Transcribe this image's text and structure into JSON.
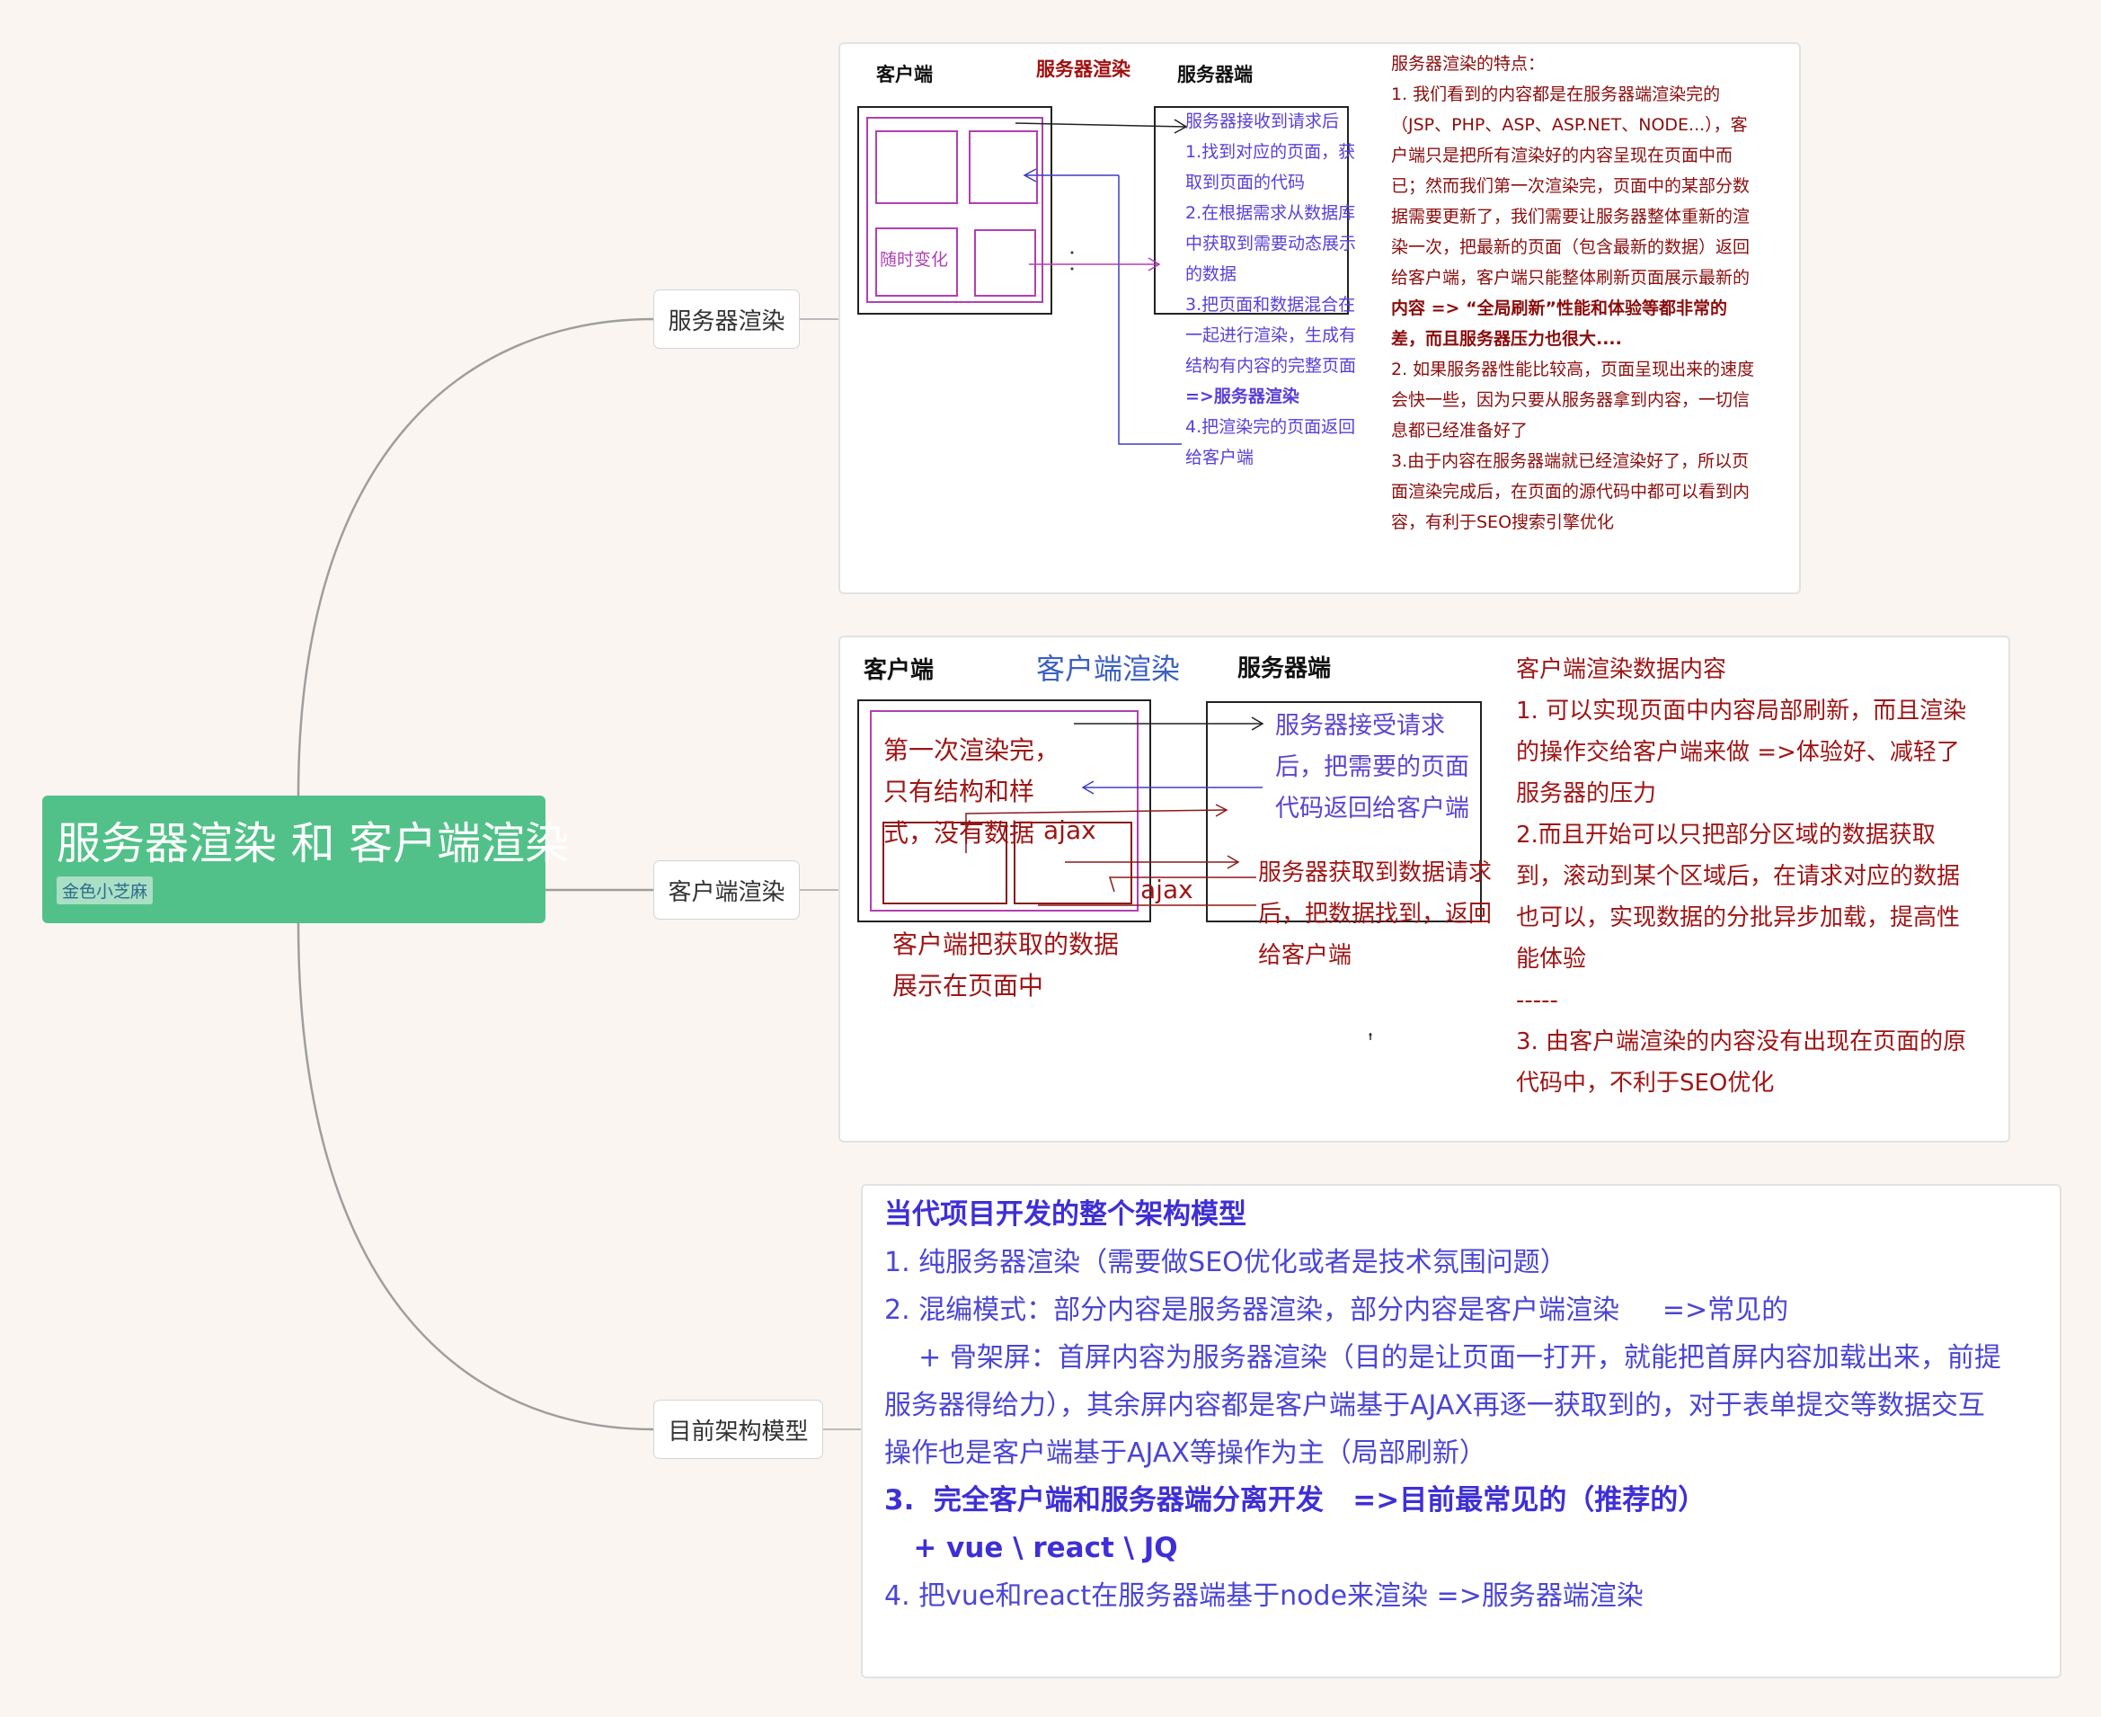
{
  "root": {
    "title": "服务器渲染 和 客户端渲染",
    "tag": "金色小芝麻"
  },
  "branches": {
    "ssr": "服务器渲染",
    "csr": "客户端渲染",
    "arch": "目前架构模型"
  },
  "ssr_card": {
    "client_label": "客户端",
    "render_label": "服务器渲染",
    "server_label": "服务器端",
    "random_change": "随时变化",
    "steps": [
      "服务器接收到请求后",
      "1.找到对应的页面，获",
      "取到页面的代码",
      "2.在根据需求从数据库",
      "中获取到需要动态展示",
      "的数据",
      "3.把页面和数据混合在",
      "一起进行渲染，生成有",
      "结构有内容的完整页面",
      "=>服务器渲染",
      "4.把渲染完的页面返回",
      "给客户端"
    ],
    "features": [
      "服务器渲染的特点：",
      "1. 我们看到的内容都是在服务器端渲染完的",
      "（JSP、PHP、ASP、ASP.NET、NODE...），客",
      "户端只是把所有渲染好的内容呈现在页面中而",
      "已；然而我们第一次渲染完，页面中的某部分数",
      "据需要更新了，我们需要让服务器整体重新的渲",
      "染一次，把最新的页面（包含最新的数据）返回",
      "给客户端，客户端只能整体刷新页面展示最新的",
      "内容 => “全局刷新”性能和体验等都非常的",
      "差，而且服务器压力也很大....",
      "2. 如果服务器性能比较高，页面呈现出来的速度",
      "会快一些，因为只要从服务器拿到内容，一切信",
      "息都已经准备好了",
      "3.由于内容在服务器端就已经渲染好了，所以页",
      "面渲染完成后，在页面的源代码中都可以看到内",
      "容，有利于SEO搜索引擎优化"
    ]
  },
  "csr_card": {
    "client_label": "客户端",
    "render_label": "客户端渲染",
    "server_label": "服务器端",
    "first_render": [
      "第一次渲染完，",
      "只有结构和样",
      "式，没有数据"
    ],
    "ajax1": "ajax",
    "ajax2": "ajax",
    "display": [
      "客户端把获取的数据",
      "展示在页面中"
    ],
    "server_steps_1": [
      "服务器接受请求",
      "后，把需要的页面",
      "代码返回给客户端"
    ],
    "server_steps_2": [
      "服务器获取到数据请求",
      "后，把数据找到，返回",
      "给客户端"
    ],
    "notes": [
      "客户端渲染数据内容",
      "1. 可以实现页面中内容局部刷新，而且渲染",
      "的操作交给客户端来做 =>体验好、减轻了",
      "服务器的压力",
      "2.而且开始可以只把部分区域的数据获取",
      "到，滚动到某个区域后，在请求对应的数据",
      "也可以，实现数据的分批异步加载，提高性",
      "能体验",
      "-----",
      "3. 由客户端渲染的内容没有出现在页面的原",
      "代码中，不利于SEO优化"
    ]
  },
  "arch_card": {
    "title": "当代项目开发的整个架构模型",
    "lines": [
      "1. 纯服务器渲染（需要做SEO优化或者是技术氛围问题）",
      "2. 混编模式：部分内容是服务器渲染，部分内容是客户端渲染     =>常见的",
      "    + 骨架屏：首屏内容为服务器渲染（目的是让页面一打开，就能把首屏内容加载出来，前提",
      "服务器得给力），其余屏内容都是客户端基于AJAX再逐一获取到的，对于表单提交等数据交互",
      "操作也是客户端基于AJAX等操作为主（局部刷新）",
      "3.  完全客户端和服务器端分离开发   =>目前最常见的（推荐的）",
      "   + vue \\ react \\ JQ",
      "4. 把vue和react在服务器端基于node来渲染 =>服务器端渲染"
    ]
  }
}
